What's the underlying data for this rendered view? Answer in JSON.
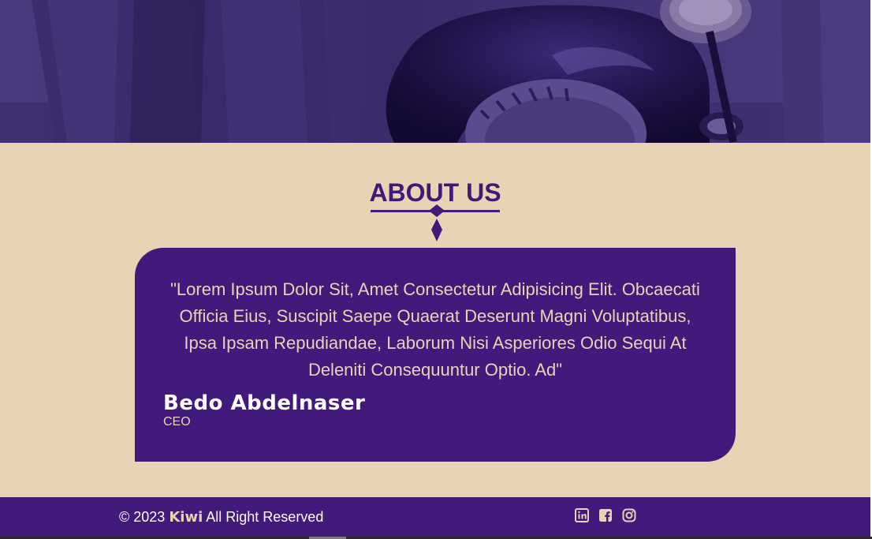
{
  "about": {
    "title": "ABOUT US",
    "quote": "\"Lorem Ipsum Dolor Sit, Amet Consectetur Adipisicing Elit. Obcaecati Officia Eius, Suscipit Saepe Quaerat Deserunt Magni Voluptatibus, Ipsa Ipsam Repudiandae, Laborum Nisi Asperiores Odio Sequi At Deleniti Consequuntur Optio. Ad\"",
    "author": "Bedo Abdelnaser",
    "role": "CEO"
  },
  "footer": {
    "copyright_prefix": "© 2023",
    "brand": "Kiwi",
    "copyright_suffix": "All Right Reserved",
    "socials": [
      {
        "icon": "linkedin-icon"
      },
      {
        "icon": "facebook-icon"
      },
      {
        "icon": "instagram-icon"
      }
    ]
  },
  "colors": {
    "primary_purple": "#421a7b",
    "beige": "#e8d4b4",
    "title_purple": "#3f1a78"
  }
}
